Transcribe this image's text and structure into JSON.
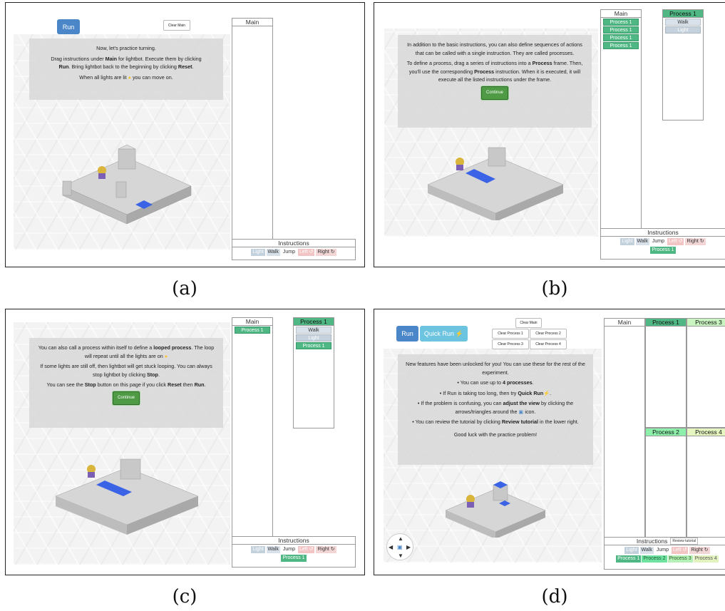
{
  "captions": [
    "(a)",
    "(b)",
    "(c)",
    "(d)"
  ],
  "common": {
    "main_label": "Main",
    "instructions_label": "Instructions",
    "light": "Light",
    "walk": "Walk",
    "jump": "Jump",
    "left": "Left ↺",
    "right": "Right ↻",
    "process1": "Process 1",
    "process2": "Process 2",
    "process3": "Process 3",
    "process4": "Process 4",
    "continue": "Continue"
  },
  "panel_a": {
    "run": "Run",
    "clear_main": "Clear Main",
    "line1": "Now, let's practice turning.",
    "line2a": "Drag instructions under ",
    "line2b": "Main",
    "line2c": " for lightbot. Execute them by clicking",
    "line3a": "Run",
    "line3b": ". Bring lightbot back to the beginning by clicking ",
    "line3c": "Reset",
    ".": ".",
    "line3d": ".",
    "line4a": "When all lights are lit ",
    "line4b": " you can move on."
  },
  "panel_b": {
    "p1": "In addition to the basic instructions, you can also define sequences of actions that can be called with a single instruction. They are called processes.",
    "p2a": "To define a process, drag a series of instructions into a ",
    "p2b": "Process",
    "p2c": " frame. Then, you'll use the corresponding ",
    "p2d": "Process",
    "p2e": " instruction. When it is executed, it will execute all the listed instructions under the frame.",
    "main_items": [
      "Process 1",
      "Process 1",
      "Process 1",
      "Process 1"
    ],
    "proc1_items": [
      "Walk",
      "Light"
    ]
  },
  "panel_c": {
    "p1a": "You can also call a process within itself to define a ",
    "p1b": "looped process",
    "p1c": ". The loop will repeat until all the lights are on ",
    "p2": "If some lights are still off, then lightbot will get stuck looping. You can always stop lightbot by clicking ",
    "p2b": "Stop",
    "p3a": "You can see the ",
    "p3b": "Stop",
    "p3c": " button on this page if you click ",
    "p3d": "Reset",
    "p3e": " then ",
    "p3f": "Run",
    "main_items": [
      "Process 1"
    ],
    "proc1_items": [
      "Walk",
      "Light",
      "Process 1"
    ]
  },
  "panel_d": {
    "run": "Run",
    "quick_run": "Quick Run",
    "clear_main": "Clear Main",
    "clear_p1": "Clear Process 1",
    "clear_p2": "Clear Process 2",
    "clear_p3": "Clear Process 3",
    "clear_p4": "Clear Process 4",
    "review": "Review tutorial",
    "intro": "New features have been unlocked for you! You can use these for the rest of the experiment.",
    "b1a": "You can use up to ",
    "b1b": "4 processes",
    "b2a": "If Run is taking too long, then try ",
    "b2b": "Quick Run",
    "b3a": "If the problem is confusing, you can ",
    "b3b": "adjust the view",
    "b3c": " by clicking the arrows/triangles around the ",
    "b3d": " icon.",
    "b4a": "You can review the tutorial by clicking ",
    "b4b": "Review tutorial",
    "b4c": " in the lower right.",
    "good": "Good luck with the practice problem!"
  }
}
